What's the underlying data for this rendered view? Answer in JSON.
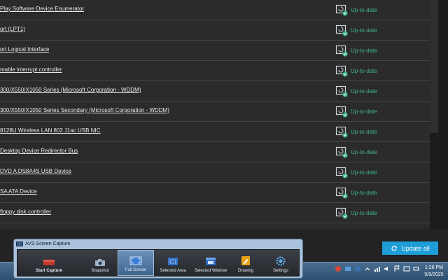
{
  "drivers": [
    {
      "name": "Play Software Device Enumerator",
      "status": "Up-to-date"
    },
    {
      "name": "ort (LPT1)",
      "status": "Up-to-date"
    },
    {
      "name": "ort Logical Interface",
      "status": "Up-to-date"
    },
    {
      "name": "mable interrupt controller",
      "status": "Up-to-date"
    },
    {
      "name": "300/X550/X1050 Series (Microsoft Corporation - WDDM)",
      "status": "Up-to-date"
    },
    {
      "name": "300/X550/X1050 Series Secondary (Microsoft Corporation - WDDM)",
      "status": "Up-to-date"
    },
    {
      "name": "8128U Wireless LAN 802.11ac USB NIC",
      "status": "Up-to-date"
    },
    {
      "name": "Desktop Device Redirector Bus",
      "status": "Up-to-date"
    },
    {
      "name": "DVD A DS8A4S USB Device",
      "status": "Up-to-date"
    },
    {
      "name": "SA ATA Device",
      "status": "Up-to-date"
    },
    {
      "name": "floppy disk controller",
      "status": "Up-to-date"
    }
  ],
  "update_all_label": "Update all",
  "avs": {
    "title": "AVS Screen Capture",
    "tools": [
      {
        "label": "Start Capture",
        "icon": "record-icon"
      },
      {
        "label": "Snapshot",
        "icon": "camera-icon"
      },
      {
        "label": "Full Screen",
        "icon": "fullscreen-icon"
      },
      {
        "label": "Selected Area",
        "icon": "area-icon"
      },
      {
        "label": "Selected Window",
        "icon": "window-icon"
      },
      {
        "label": "Drawing",
        "icon": "drawing-icon"
      },
      {
        "label": "Settings",
        "icon": "gear-icon"
      }
    ]
  },
  "clock": {
    "time": "1:26 PM",
    "date": "5/9/2025"
  },
  "colors": {
    "status_green": "#3fb48a",
    "accent_blue": "#1e9ed8"
  }
}
